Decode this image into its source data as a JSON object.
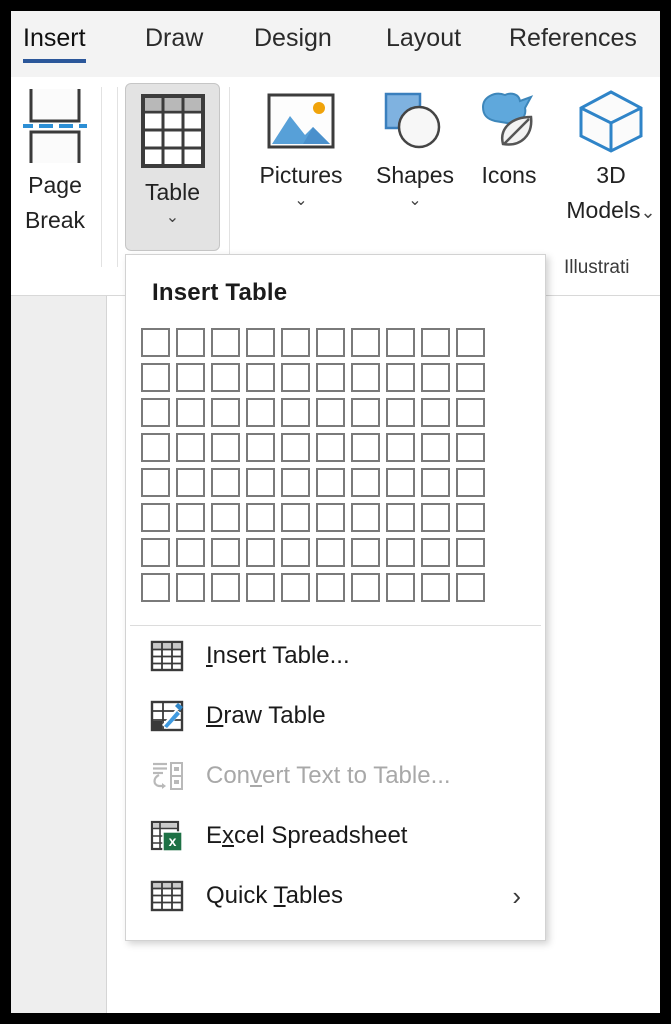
{
  "window": {
    "app": "word-ribbon"
  },
  "ribbon": {
    "tabs": [
      {
        "label": "Insert",
        "active": true
      },
      {
        "label": "Draw",
        "active": false
      },
      {
        "label": "Design",
        "active": false
      },
      {
        "label": "Layout",
        "active": false
      },
      {
        "label": "References",
        "active": false
      }
    ],
    "accent_color": "#2b579a",
    "buttons": {
      "page_break": {
        "label_line1": "Page",
        "label_line2": "Break",
        "icon": "page-break-icon"
      },
      "table": {
        "label": "Table",
        "icon": "table-icon",
        "caret": "⌄",
        "selected": true
      },
      "pictures": {
        "label": "Pictures",
        "icon": "pictures-icon",
        "caret": "⌄"
      },
      "shapes": {
        "label": "Shapes",
        "icon": "shapes-icon",
        "caret": "⌄"
      },
      "icons": {
        "label": "Icons",
        "icon": "icons-icon"
      },
      "models3d": {
        "label_line1": "3D",
        "label_line2": "Models",
        "icon": "cube-icon",
        "caret": "⌄"
      }
    },
    "groups": {
      "illustrations": {
        "label": "Illustrati"
      }
    }
  },
  "table_menu": {
    "title": "Insert Table",
    "grid": {
      "rows": 8,
      "cols": 10,
      "selected_rows": 0,
      "selected_cols": 0
    },
    "items": [
      {
        "label_pre": "",
        "label_accel": "I",
        "label_post": "nsert Table...",
        "icon": "table-grid-icon",
        "disabled": false,
        "submenu": false
      },
      {
        "label_pre": "",
        "label_accel": "D",
        "label_post": "raw Table",
        "icon": "draw-table-icon",
        "disabled": false,
        "submenu": false
      },
      {
        "label_pre": "Con",
        "label_accel": "v",
        "label_post": "ert Text to Table...",
        "icon": "convert-text-icon",
        "disabled": true,
        "submenu": false
      },
      {
        "label_pre": "E",
        "label_accel": "x",
        "label_post": "cel Spreadsheet",
        "icon": "excel-icon",
        "disabled": false,
        "submenu": false
      },
      {
        "label_pre": "Quick ",
        "label_accel": "T",
        "label_post": "ables",
        "icon": "quick-tables-icon",
        "disabled": false,
        "submenu": true,
        "submenu_glyph": "›"
      }
    ]
  }
}
